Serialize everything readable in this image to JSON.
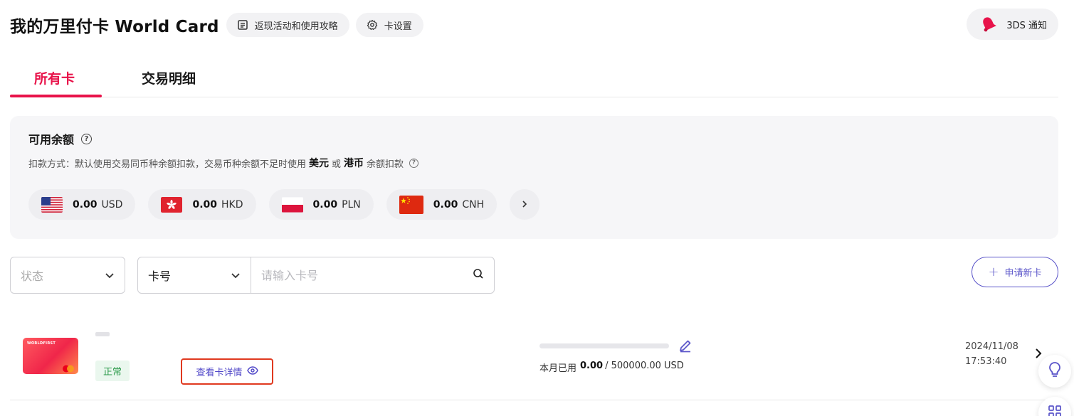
{
  "header": {
    "title": "我的万里付卡 World Card",
    "rebate_label": "返现活动和使用攻略",
    "settings_label": "卡设置",
    "notify_label": "3DS 通知"
  },
  "tabs": [
    {
      "label": "所有卡",
      "active": true
    },
    {
      "label": "交易明细",
      "active": false
    }
  ],
  "balance": {
    "title": "可用余额",
    "deduct_prefix": "扣款方式：默认使用交易同币种余额扣款，交易币种余额不足时使用",
    "deduct_cur1": "美元",
    "deduct_or": "或",
    "deduct_cur2": "港币",
    "deduct_suffix": "余额扣款",
    "currencies": [
      {
        "amount": "0.00",
        "code": "USD",
        "flag": "us-flag"
      },
      {
        "amount": "0.00",
        "code": "HKD",
        "flag": "hk-flag"
      },
      {
        "amount": "0.00",
        "code": "PLN",
        "flag": "pl-flag"
      },
      {
        "amount": "0.00",
        "code": "CNH",
        "flag": "cn-flag"
      }
    ]
  },
  "filters": {
    "status_placeholder": "状态",
    "type_value": "卡号",
    "search_placeholder": "请输入卡号"
  },
  "apply_button": {
    "label": "申请新卡"
  },
  "card": {
    "brand": "WORLDFIRST",
    "status": "正常",
    "detail_link": "查看卡详情",
    "usage_label": "本月已用",
    "usage_amount": "0.00",
    "usage_limit": "/ 500000.00 USD",
    "usage_fraction": 0,
    "date": "2024/11/08",
    "time": "17:53:40"
  },
  "colors": {
    "accent": "#e8134a",
    "link": "#4f46c8",
    "status_green": "#2b9a4a",
    "highlight_border": "#e0391f"
  }
}
